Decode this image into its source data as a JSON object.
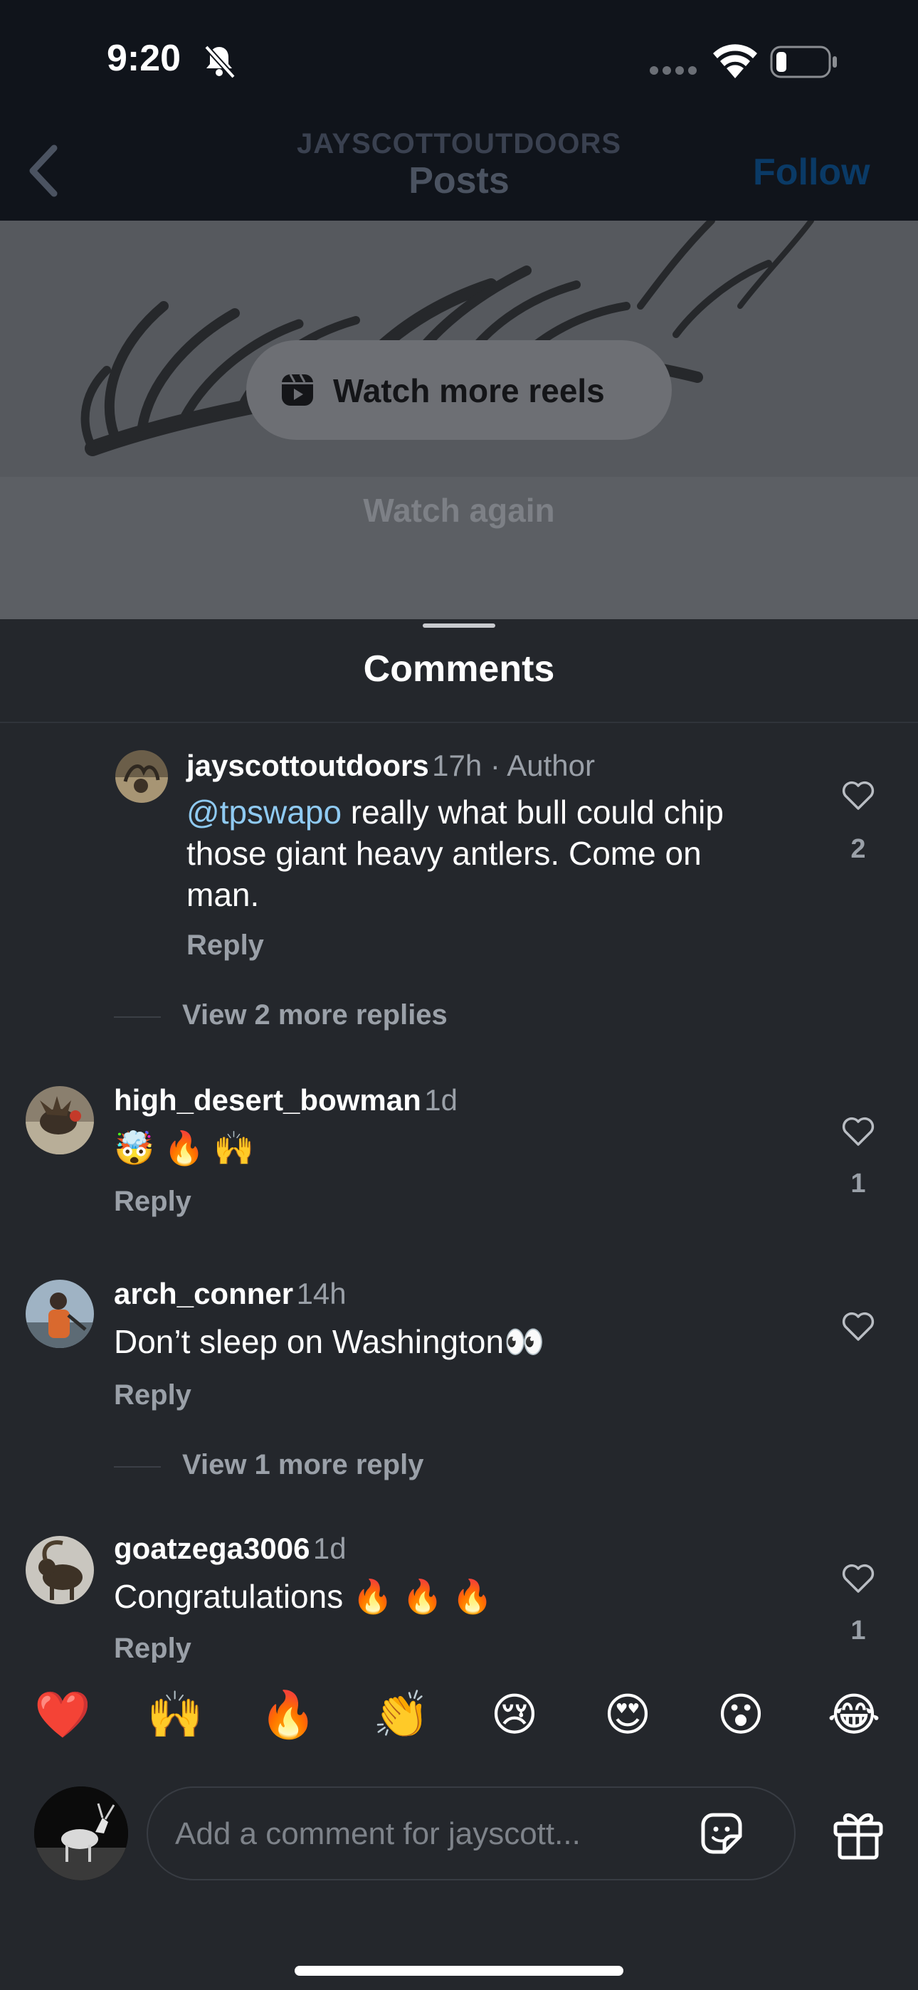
{
  "status_bar": {
    "time": "9:20"
  },
  "header": {
    "username": "JAYSCOTTOUTDOORS",
    "title": "Posts",
    "follow_label": "Follow"
  },
  "video_overlay": {
    "watch_more_label": "Watch more reels",
    "watch_again_label": "Watch again"
  },
  "comments_sheet": {
    "title": "Comments",
    "comments": [
      {
        "username": "jayscottoutdoors",
        "meta": "17h · Author",
        "mention": "@tpswapo",
        "line1_rest": " really what bull could chip",
        "line2": "those giant heavy antlers.  Come on",
        "line3": "man.",
        "reply_label": "Reply",
        "likes": "2",
        "more_replies": "View 2 more replies"
      },
      {
        "username": "high_desert_bowman",
        "meta": "1d",
        "text": "🤯 🔥 🙌",
        "reply_label": "Reply",
        "likes": "1"
      },
      {
        "username": "arch_conner",
        "meta": "14h",
        "text": "Don’t sleep on Washington👀",
        "reply_label": "Reply",
        "more_replies": "View 1 more reply"
      },
      {
        "username": "goatzega3006",
        "meta": "1d",
        "text": "Congratulations 🔥 🔥 🔥",
        "reply_label": "Reply",
        "likes": "1"
      }
    ]
  },
  "reactions": [
    "❤️",
    "🙌",
    "🔥",
    "👏",
    "😢",
    "😍",
    "😮",
    "😂"
  ],
  "composer": {
    "placeholder": "Add a comment for jayscott..."
  }
}
